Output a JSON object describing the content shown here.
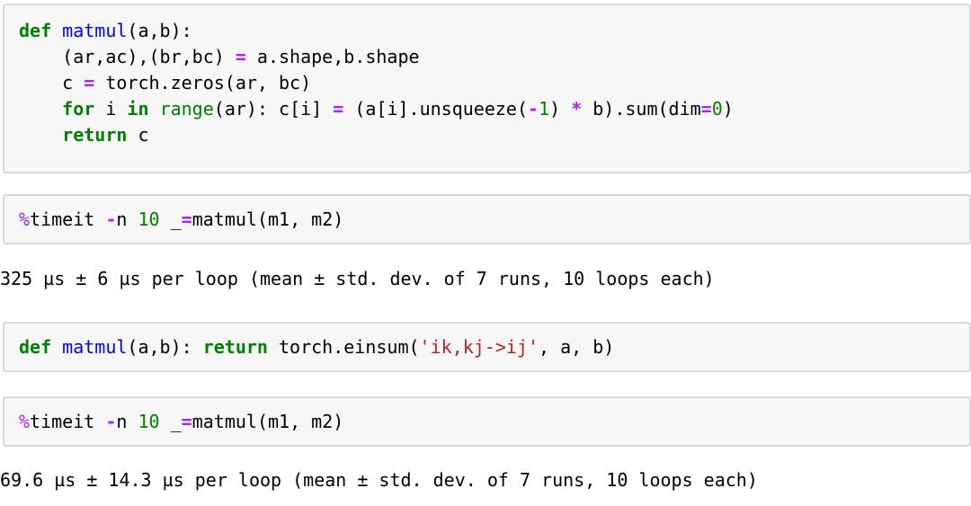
{
  "cells": [
    {
      "type": "code",
      "lines": [
        [
          {
            "t": "kw",
            "v": "def"
          },
          {
            "t": "",
            "v": " "
          },
          {
            "t": "fn",
            "v": "matmul"
          },
          {
            "t": "",
            "v": "(a,b):"
          }
        ],
        [
          {
            "t": "",
            "v": "    (ar,ac),(br,bc) "
          },
          {
            "t": "op",
            "v": "="
          },
          {
            "t": "",
            "v": " a.shape,b.shape"
          }
        ],
        [
          {
            "t": "",
            "v": "    c "
          },
          {
            "t": "op",
            "v": "="
          },
          {
            "t": "",
            "v": " torch.zeros(ar, bc)"
          }
        ],
        [
          {
            "t": "",
            "v": "    "
          },
          {
            "t": "kw",
            "v": "for"
          },
          {
            "t": "",
            "v": " i "
          },
          {
            "t": "kw",
            "v": "in"
          },
          {
            "t": "",
            "v": " "
          },
          {
            "t": "bi",
            "v": "range"
          },
          {
            "t": "",
            "v": "(ar): c[i] "
          },
          {
            "t": "op",
            "v": "="
          },
          {
            "t": "",
            "v": " (a[i].unsqueeze("
          },
          {
            "t": "op",
            "v": "-"
          },
          {
            "t": "num",
            "v": "1"
          },
          {
            "t": "",
            "v": ") "
          },
          {
            "t": "op",
            "v": "*"
          },
          {
            "t": "",
            "v": " b).sum(dim"
          },
          {
            "t": "op",
            "v": "="
          },
          {
            "t": "num",
            "v": "0"
          },
          {
            "t": "",
            "v": ")"
          }
        ],
        [
          {
            "t": "",
            "v": "    "
          },
          {
            "t": "kw",
            "v": "return"
          },
          {
            "t": "",
            "v": " c"
          }
        ]
      ]
    },
    {
      "type": "code",
      "lines": [
        [
          {
            "t": "magic",
            "v": "%"
          },
          {
            "t": "",
            "v": "timeit "
          },
          {
            "t": "op",
            "v": "-"
          },
          {
            "t": "",
            "v": "n "
          },
          {
            "t": "num",
            "v": "10"
          },
          {
            "t": "",
            "v": " _"
          },
          {
            "t": "op",
            "v": "="
          },
          {
            "t": "",
            "v": "matmul(m1, m2)"
          }
        ]
      ],
      "output": "325 µs ± 6 µs per loop (mean ± std. dev. of 7 runs, 10 loops each)"
    },
    {
      "type": "code",
      "lines": [
        [
          {
            "t": "kw",
            "v": "def"
          },
          {
            "t": "",
            "v": " "
          },
          {
            "t": "fn",
            "v": "matmul"
          },
          {
            "t": "",
            "v": "(a,b): "
          },
          {
            "t": "kw",
            "v": "return"
          },
          {
            "t": "",
            "v": " torch.einsum("
          },
          {
            "t": "str",
            "v": "'ik,kj->ij'"
          },
          {
            "t": "",
            "v": ", a, b)"
          }
        ]
      ]
    },
    {
      "type": "code",
      "lines": [
        [
          {
            "t": "magic",
            "v": "%"
          },
          {
            "t": "",
            "v": "timeit "
          },
          {
            "t": "op",
            "v": "-"
          },
          {
            "t": "",
            "v": "n "
          },
          {
            "t": "num",
            "v": "10"
          },
          {
            "t": "",
            "v": " _"
          },
          {
            "t": "op",
            "v": "="
          },
          {
            "t": "",
            "v": "matmul(m1, m2)"
          }
        ]
      ],
      "output": "69.6 µs ± 14.3 µs per loop (mean ± std. dev. of 7 runs, 10 loops each)"
    }
  ],
  "colors": {
    "keyword": "#008000",
    "function": "#0000ff",
    "operator": "#aa22ff",
    "number": "#008000",
    "string": "#ba2121",
    "cell_bg": "#f7f7f7",
    "cell_border": "#d9d9d9"
  }
}
